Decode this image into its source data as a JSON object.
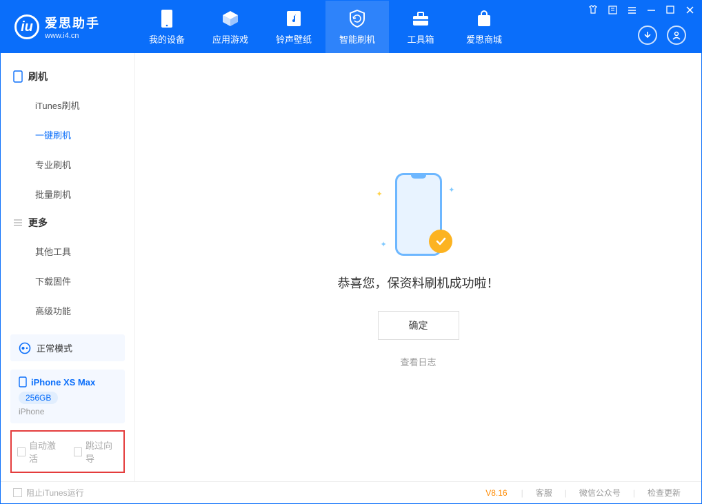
{
  "app": {
    "title": "爱思助手",
    "subtitle": "www.i4.cn"
  },
  "nav": {
    "tabs": [
      {
        "label": "我的设备"
      },
      {
        "label": "应用游戏"
      },
      {
        "label": "铃声壁纸"
      },
      {
        "label": "智能刷机"
      },
      {
        "label": "工具箱"
      },
      {
        "label": "爱思商城"
      }
    ]
  },
  "sidebar": {
    "section1_title": "刷机",
    "section1_items": [
      "iTunes刷机",
      "一键刷机",
      "专业刷机",
      "批量刷机"
    ],
    "section2_title": "更多",
    "section2_items": [
      "其他工具",
      "下载固件",
      "高级功能"
    ]
  },
  "mode": {
    "label": "正常模式"
  },
  "device": {
    "name": "iPhone XS Max",
    "capacity": "256GB",
    "type": "iPhone"
  },
  "bottom_checks": {
    "auto_activate": "自动激活",
    "skip_guide": "跳过向导"
  },
  "main": {
    "success_msg": "恭喜您，保资料刷机成功啦！",
    "confirm_label": "确定",
    "view_log_label": "查看日志"
  },
  "statusbar": {
    "block_itunes": "阻止iTunes运行",
    "version": "V8.16",
    "links": [
      "客服",
      "微信公众号",
      "检查更新"
    ]
  }
}
